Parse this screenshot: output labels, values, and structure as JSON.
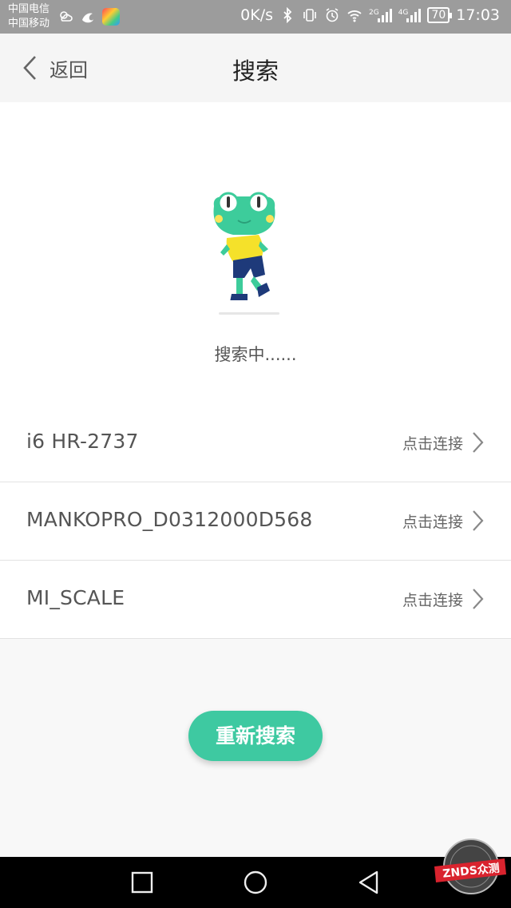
{
  "status_bar": {
    "carrier_1": "中国电信",
    "carrier_2": "中国移动",
    "speed": "0K/s",
    "net_1": "2G",
    "net_2": "4G",
    "battery": "70",
    "time": "17:03"
  },
  "nav": {
    "back_label": "返回",
    "title": "搜索"
  },
  "search": {
    "status": "搜索中......"
  },
  "devices": [
    {
      "name": "i6 HR-2737",
      "action": "点击连接"
    },
    {
      "name": "MANKOPRO_D0312000D568",
      "action": "点击连接"
    },
    {
      "name": "MI_SCALE",
      "action": "点击连接"
    }
  ],
  "rescan_label": "重新搜索",
  "watermark": "ZNDS众测",
  "colors": {
    "accent": "#3ec9a1",
    "mascot_green": "#3dcc9b",
    "mascot_shirt": "#f5e12a"
  }
}
